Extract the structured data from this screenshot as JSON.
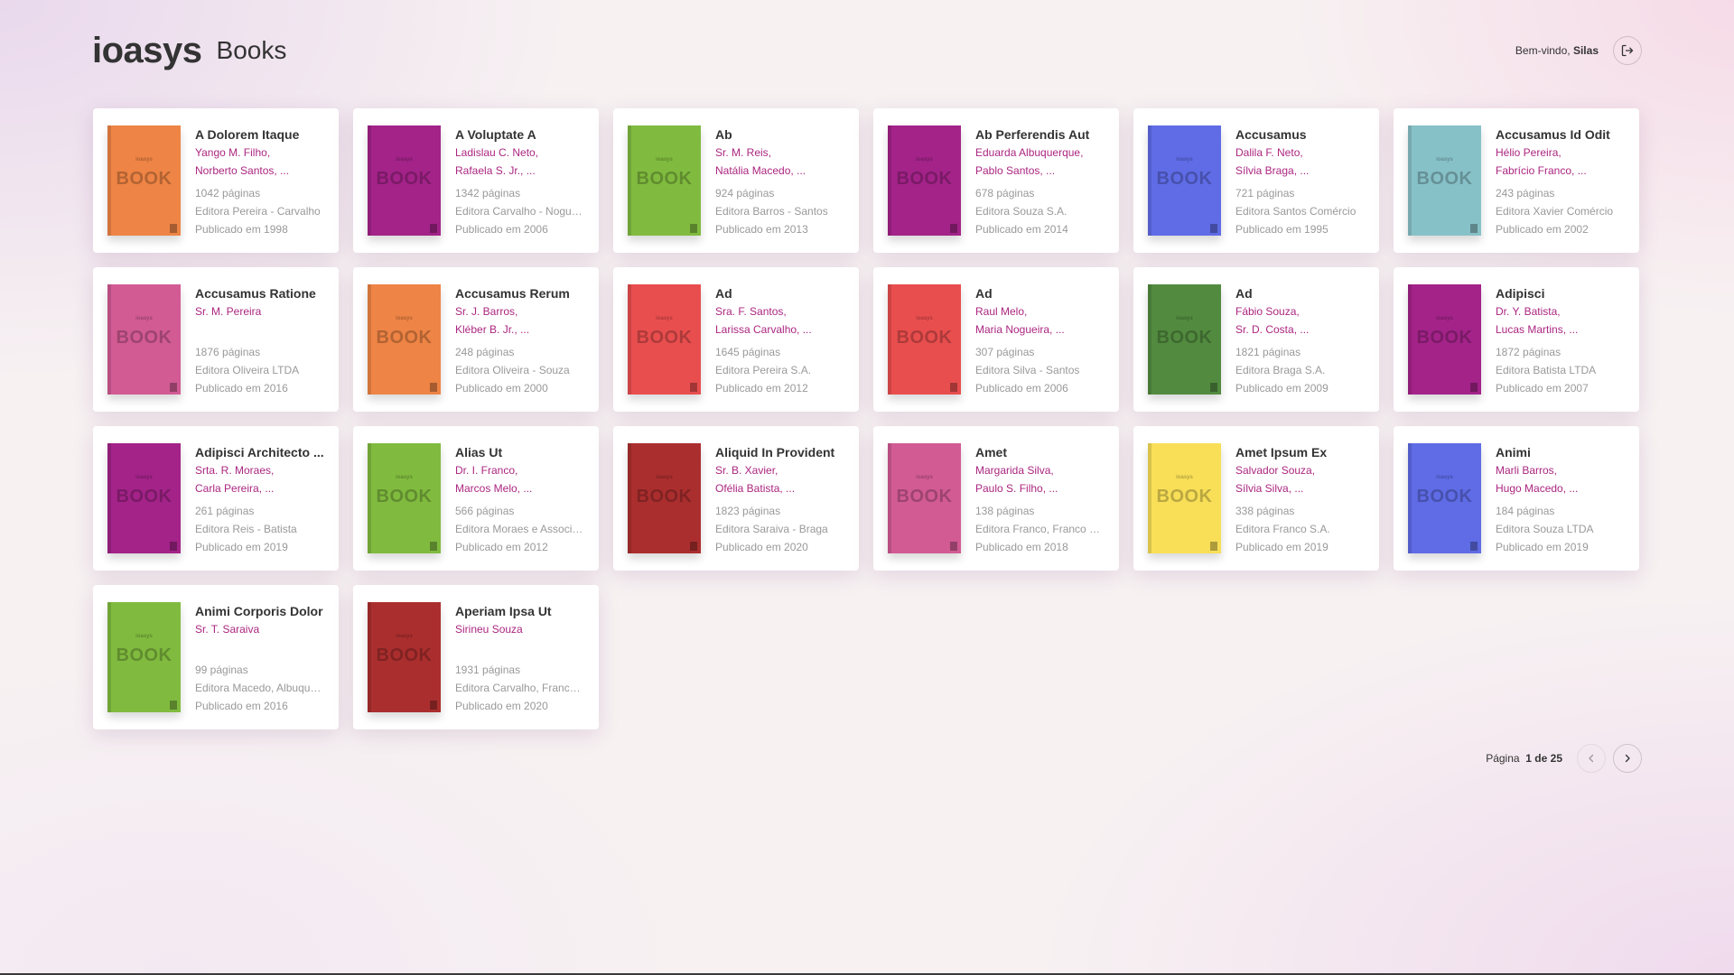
{
  "header": {
    "logo": "ioasys",
    "title": "Books",
    "welcome_prefix": "Bem-vindo,",
    "user_name": "Silas",
    "logout_icon": "logout-icon"
  },
  "pagination": {
    "label": "Página",
    "current": "1",
    "separator": "de",
    "total": "25",
    "prev_icon": "chevron-left-icon",
    "next_icon": "chevron-right-icon"
  },
  "cover_text": {
    "brand": "ioasys",
    "word": "BOOK"
  },
  "colors": {
    "accent": "#ab2680",
    "text": "#333333",
    "muted": "#999999"
  },
  "books": [
    {
      "title": "A Dolorem Itaque",
      "author1": "Yango M. Filho,",
      "author2": "Norberto Santos, ...",
      "pages": "1042 páginas",
      "publisher": "Editora Pereira - Carvalho",
      "published": "Publicado em 1998",
      "color": "#ee8445"
    },
    {
      "title": "A Voluptate A",
      "author1": "Ladislau C. Neto,",
      "author2": "Rafaela S. Jr., ...",
      "pages": "1342 páginas",
      "publisher": "Editora Carvalho - Nogueira",
      "published": "Publicado em 2006",
      "color": "#a32389"
    },
    {
      "title": "Ab",
      "author1": "Sr. M. Reis,",
      "author2": "Natália Macedo, ...",
      "pages": "924 páginas",
      "publisher": "Editora Barros - Santos",
      "published": "Publicado em 2013",
      "color": "#80bb3f"
    },
    {
      "title": "Ab Perferendis Aut",
      "author1": "Eduarda Albuquerque,",
      "author2": "Pablo Santos, ...",
      "pages": "678 páginas",
      "publisher": "Editora Souza S.A.",
      "published": "Publicado em 2014",
      "color": "#a32389"
    },
    {
      "title": "Accusamus",
      "author1": "Dalila F. Neto,",
      "author2": "Sílvia Braga, ...",
      "pages": "721 páginas",
      "publisher": "Editora Santos Comércio",
      "published": "Publicado em 1995",
      "color": "#5f6ce6"
    },
    {
      "title": "Accusamus Id Odit",
      "author1": "Hélio Pereira,",
      "author2": "Fabrício Franco, ...",
      "pages": "243 páginas",
      "publisher": "Editora Xavier Comércio",
      "published": "Publicado em 2002",
      "color": "#87c1c8"
    },
    {
      "title": "Accusamus Ratione",
      "author1": "Sr. M. Pereira",
      "author2": "",
      "pages": "1876 páginas",
      "publisher": "Editora Oliveira LTDA",
      "published": "Publicado em 2016",
      "color": "#d25b94"
    },
    {
      "title": "Accusamus Rerum",
      "author1": "Sr. J. Barros,",
      "author2": "Kléber B. Jr., ...",
      "pages": "248 páginas",
      "publisher": "Editora Oliveira - Souza",
      "published": "Publicado em 2000",
      "color": "#ee8445"
    },
    {
      "title": "Ad",
      "author1": "Sra. F. Santos,",
      "author2": "Larissa Carvalho, ...",
      "pages": "1645 páginas",
      "publisher": "Editora Pereira S.A.",
      "published": "Publicado em 2012",
      "color": "#e94e4e"
    },
    {
      "title": "Ad",
      "author1": "Raul Melo,",
      "author2": "Maria Nogueira, ...",
      "pages": "307 páginas",
      "publisher": "Editora Silva - Santos",
      "published": "Publicado em 2006",
      "color": "#e94e4e"
    },
    {
      "title": "Ad",
      "author1": "Fábio Souza,",
      "author2": "Sr. D. Costa, ...",
      "pages": "1821 páginas",
      "publisher": "Editora Braga S.A.",
      "published": "Publicado em 2009",
      "color": "#528b3f"
    },
    {
      "title": "Adipisci",
      "author1": "Dr. Y. Batista,",
      "author2": "Lucas Martins, ...",
      "pages": "1872 páginas",
      "publisher": "Editora Batista LTDA",
      "published": "Publicado em 2007",
      "color": "#a32389"
    },
    {
      "title": "Adipisci Architecto ...",
      "author1": "Srta. R. Moraes,",
      "author2": "Carla Pereira, ...",
      "pages": "261 páginas",
      "publisher": "Editora Reis - Batista",
      "published": "Publicado em 2019",
      "color": "#a32389"
    },
    {
      "title": "Alias Ut",
      "author1": "Dr. I. Franco,",
      "author2": "Marcos Melo, ...",
      "pages": "566 páginas",
      "publisher": "Editora Moraes e Associados",
      "published": "Publicado em 2012",
      "color": "#80bb3f"
    },
    {
      "title": "Aliquid In Provident",
      "author1": "Sr. B. Xavier,",
      "author2": "Ofélia Batista, ...",
      "pages": "1823 páginas",
      "publisher": "Editora Saraiva - Braga",
      "published": "Publicado em 2020",
      "color": "#ab2e2e"
    },
    {
      "title": "Amet",
      "author1": "Margarida Silva,",
      "author2": "Paulo S. Filho, ...",
      "pages": "138 páginas",
      "publisher": "Editora Franco, Franco e Associados",
      "published": "Publicado em 2018",
      "color": "#d25b94"
    },
    {
      "title": "Amet Ipsum Ex",
      "author1": "Salvador Souza,",
      "author2": "Sílvia Silva, ...",
      "pages": "338 páginas",
      "publisher": "Editora Franco S.A.",
      "published": "Publicado em 2019",
      "color": "#f8df57"
    },
    {
      "title": "Animi",
      "author1": "Marli Barros,",
      "author2": "Hugo Macedo, ...",
      "pages": "184 páginas",
      "publisher": "Editora Souza LTDA",
      "published": "Publicado em 2019",
      "color": "#5f6ce6"
    },
    {
      "title": "Animi Corporis Dolor",
      "author1": "Sr. T. Saraiva",
      "author2": "",
      "pages": "99 páginas",
      "publisher": "Editora Macedo, Albuquerque",
      "published": "Publicado em 2016",
      "color": "#80bb3f"
    },
    {
      "title": "Aperiam Ipsa Ut",
      "author1": "Sirineu Souza",
      "author2": "",
      "pages": "1931 páginas",
      "publisher": "Editora Carvalho, Franco e Associados",
      "published": "Publicado em 2020",
      "color": "#ab2e2e"
    }
  ]
}
